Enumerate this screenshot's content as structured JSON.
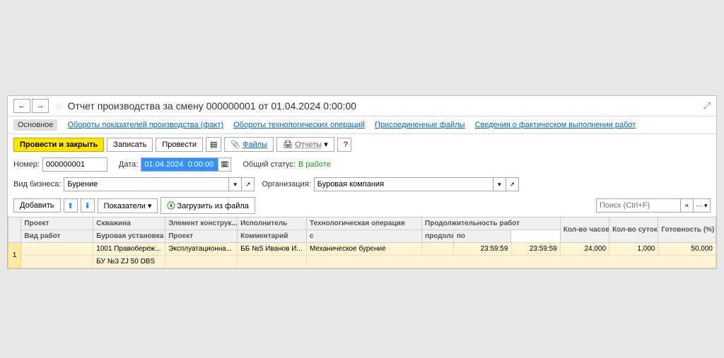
{
  "title": "Отчет производства за смену 000000001 от 01.04.2024 0:00:00",
  "tabs": {
    "main": "Основное",
    "t1": "Обороты показателей производства (факт)",
    "t2": "Обороты технологических операций",
    "t3": "Присоединенные файлы",
    "t4": "Сведения о фактическом выполнении работ"
  },
  "toolbar": {
    "post_close": "Провести и закрыть",
    "save": "Записать",
    "post": "Провести",
    "files": "Файлы",
    "reports": "Отчеты"
  },
  "fields": {
    "num_label": "Номер:",
    "num_value": "000000001",
    "date_label": "Дата:",
    "date_value": "01.04.2024  0:00:00",
    "status_label": "Общий статус:",
    "status_value": "В работе",
    "biz_label": "Вид бизнеса:",
    "biz_value": "Бурение",
    "org_label": "Организация:",
    "org_value": "Буровая компания"
  },
  "tb2": {
    "add": "Добавить",
    "indicators": "Показатели",
    "load": "Загрузить из файла",
    "search_ph": "Поиск (Ctrl+F)"
  },
  "cols": {
    "project": "Проект",
    "well": "Скважина",
    "elem": "Элемент конструк...",
    "exec": "Исполнитель",
    "techop": "Технологическая операция",
    "duration": "Продолжительность работ",
    "worktype": "Вид работ",
    "rig": "Буровая установка",
    "project2": "Проект",
    "comment": "Комментарий",
    "from": "с",
    "dur_hm": "продолж. (ч:м)",
    "to": "по",
    "hours": "Кол-во часов",
    "days": "Кол-во суток",
    "ready": "Готовность (%)"
  },
  "row": {
    "n": "1",
    "well": "1001 Правобереж...",
    "elem": "Эксплуатационна...",
    "exec": "ББ №5 Иванов И...",
    "techop": "Механическое бурение",
    "rig": "БУ №3 ZJ 50 DBS",
    "dur_hm": "23:59:59",
    "to": "23:59:59",
    "hours": "24,000",
    "days": "1,000",
    "ready": "50,000"
  }
}
